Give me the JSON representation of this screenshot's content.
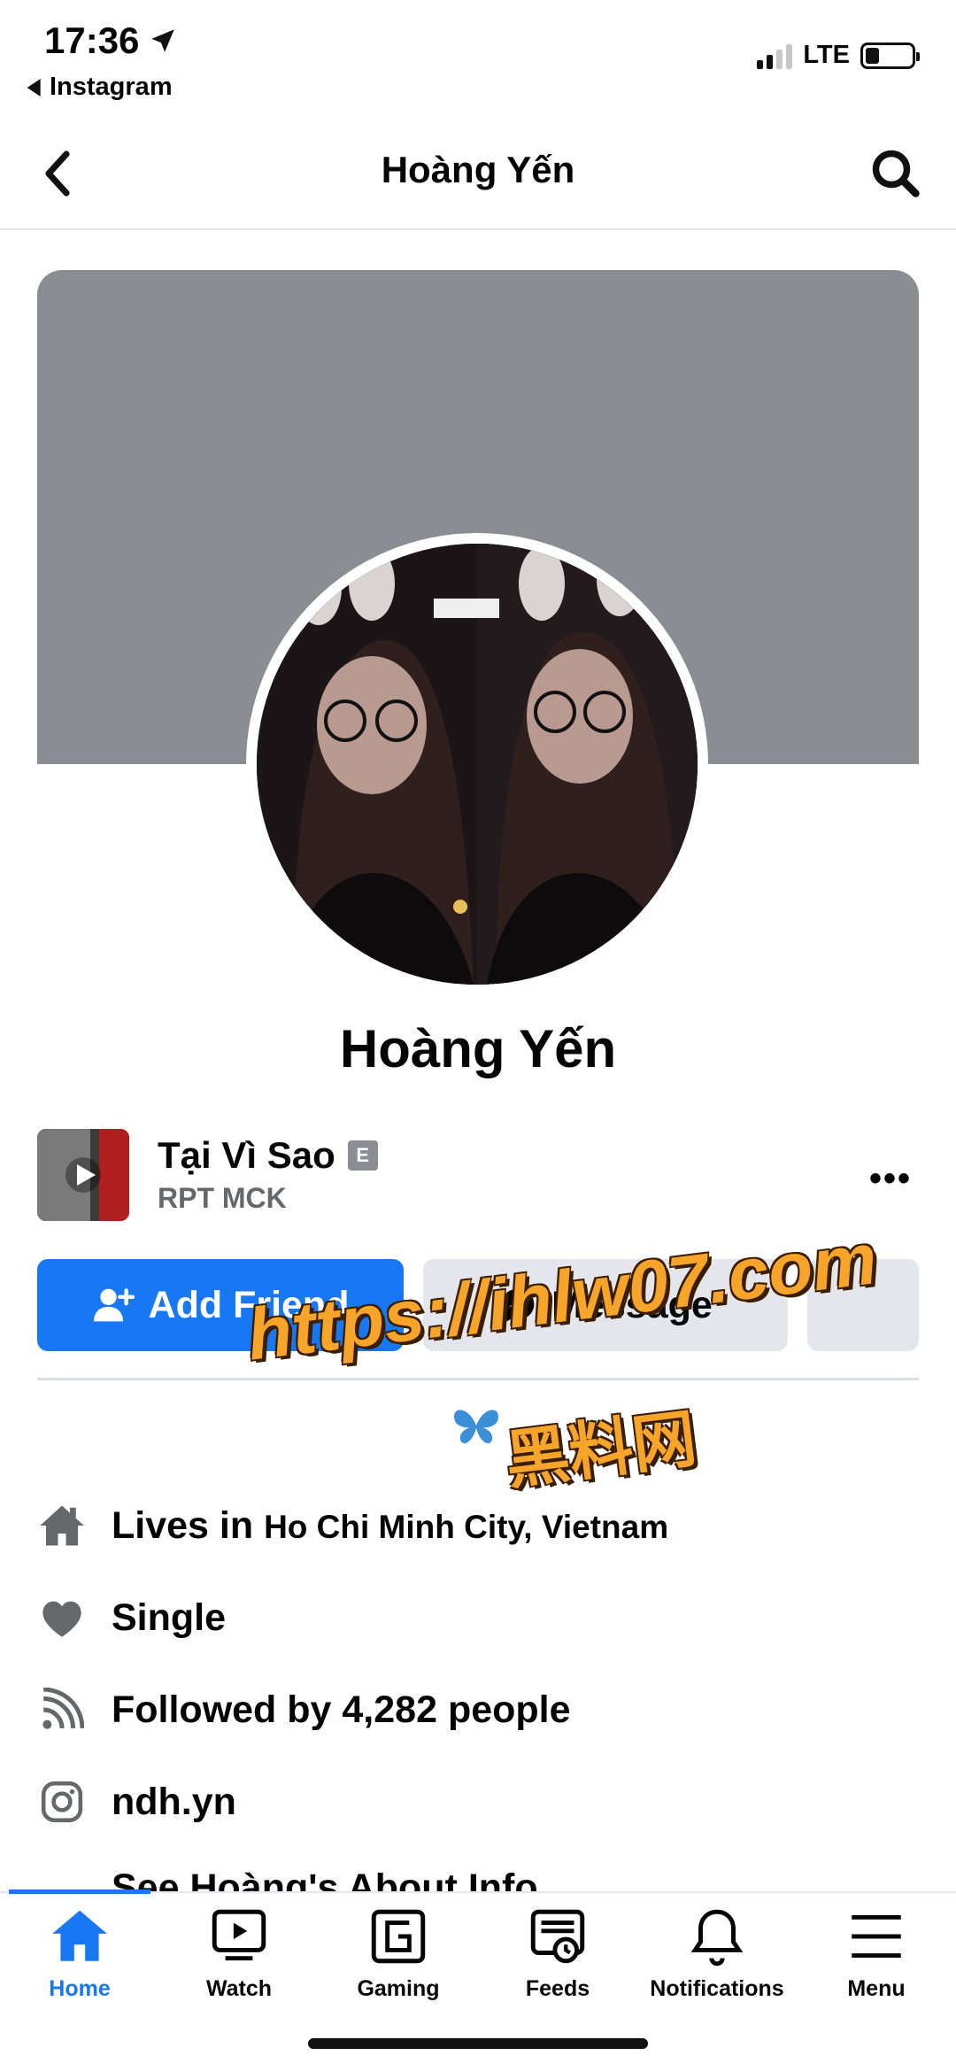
{
  "status_bar": {
    "time": "17:36",
    "back_app": "Instagram",
    "network": "LTE"
  },
  "header": {
    "title": "Hoàng Yến"
  },
  "profile": {
    "name": "Hoàng Yến"
  },
  "music": {
    "title": "Tại Vì Sao",
    "explicit": "E",
    "artist": "RPT MCK",
    "more": "•••"
  },
  "actions": {
    "add_friend": "Add Friend",
    "message": "Message"
  },
  "watermark": {
    "url": "https://ihlw07.com",
    "text": "黑料网"
  },
  "info": {
    "lives_prefix": "Lives in ",
    "lives_city": "Ho Chi Minh City, Vietnam",
    "relationship": "Single",
    "followed": "Followed by 4,282 people",
    "instagram": "ndh.yn",
    "see_about": "See Hoàng's About Info"
  },
  "tabs": [
    {
      "label": "Home",
      "icon": "home-icon"
    },
    {
      "label": "Watch",
      "icon": "watch-icon"
    },
    {
      "label": "Gaming",
      "icon": "gaming-icon"
    },
    {
      "label": "Feeds",
      "icon": "feeds-icon"
    },
    {
      "label": "Notifications",
      "icon": "bell-icon"
    },
    {
      "label": "Menu",
      "icon": "menu-icon"
    }
  ],
  "colors": {
    "accent": "#1877f2",
    "cover": "#8a8d91",
    "secondary_button": "#e4e6eb"
  }
}
